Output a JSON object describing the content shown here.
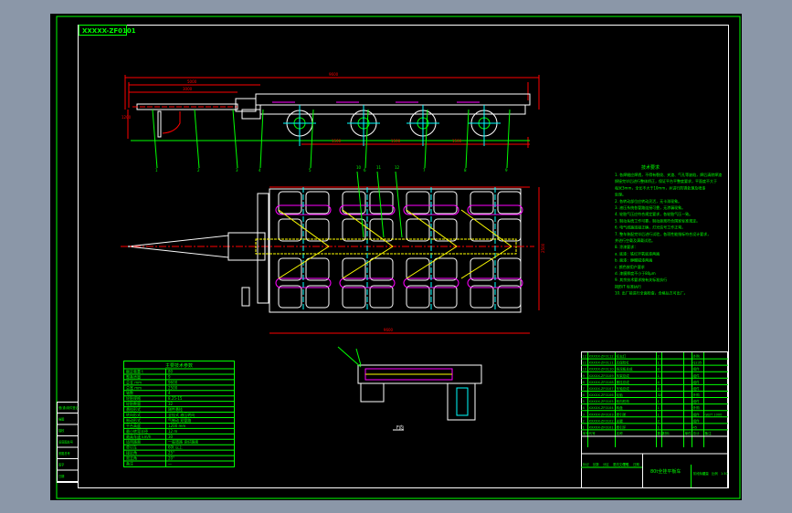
{
  "drawing": {
    "code_label": "XXXXX-ZF0101",
    "colors": {
      "background": "#000000",
      "frame": "#00ff00",
      "border": "#ffffff",
      "dimension": "#ff0000",
      "centerline": "#00ffff",
      "highlight": "#ffff00",
      "accent": "#ff00ff",
      "app_chrome": "#8b97a8"
    },
    "side_view": {
      "dimensions": [
        "9600",
        "5000",
        "3000",
        "1500",
        "1500",
        "1500",
        "1200"
      ],
      "balloons": [
        "1",
        "2",
        "3",
        "4",
        "5",
        "6",
        "7",
        "8",
        "9"
      ]
    },
    "top_view": {
      "dimensions": [
        "9600",
        "2500"
      ],
      "balloons": [
        "10",
        "11",
        "12"
      ]
    },
    "tech_requirements": {
      "title": "技术要求",
      "lines": [
        "1. 各焊缝应焊透，不得有裂纹、夹渣、气孔等缺陷，焊后清除焊渣",
        "   焊接完毕后进行整体矫正，保证平台平整度要求，平面度不大于",
        "   每米3mm，全长不大于10mm，并进行防锈处理及喷漆",
        "   处理。",
        "2. 各转动部位应转动灵活，无卡滞现象。",
        "3. 液压系统各管路连接可靠，无渗漏现象。",
        "4. 轮胎气压应符合规定要求，各轮胎气压一致。",
        "5. 制动系统工作可靠，制动距离符合国家标准规定。",
        "6. 电气线路连接正确，灯光信号工作正常。",
        "7. 整车装配完毕后进行试验，各项性能指标符合设计要求，",
        "   并进行空载及满载试验。",
        "8. 涂漆要求：",
        "  a. 底漆：铁红环氧底漆两遍",
        "  b. 面漆：醇酸磁漆两遍",
        "  c. 颜色按用户要求",
        "  d. 漆膜厚度不小于80μm",
        "9. 其余技术要求按有关标准执行",
        "        按JB/T 标准执行",
        "10. 出厂前进行全面检查，合格后方可出厂。"
      ]
    },
    "parameters": {
      "title": "主要技术参数",
      "rows": [
        [
          "额定载重 t",
          "80"
        ],
        [
          "整备质量",
          "9"
        ],
        [
          "总长 mm",
          "9600"
        ],
        [
          "总宽 mm",
          "2500"
        ],
        [
          "轴数",
          "4"
        ],
        [
          "轮胎规格",
          "8.25-15"
        ],
        [
          "轮胎数量",
          "32"
        ],
        [
          "悬挂形式",
          "刚性悬挂"
        ],
        [
          "转向形式",
          "全挂式 液压转向"
        ],
        [
          "制动形式",
          "气制动 双管路"
        ],
        [
          "平台高度",
          "1200 mm"
        ],
        [
          "最小转弯半径",
          "12 m"
        ],
        [
          "最高车速 km/h",
          "30"
        ],
        [
          "适用路面",
          "一般道路 良好路面"
        ],
        [
          "牵引车",
          "60t 以上"
        ],
        [
          "接近角",
          "25°"
        ],
        [
          "离去角",
          "20°"
        ],
        [
          "备注",
          "—"
        ]
      ]
    },
    "parts_list": {
      "rows": [
        [
          "12",
          "XXXXX-ZF0112",
          "标志灯",
          "2",
          "",
          "",
          "外购",
          ""
        ],
        [
          "11",
          "XXXXX-ZF0111",
          "后保险杠",
          "1",
          "",
          "",
          "Q235",
          ""
        ],
        [
          "10",
          "XXXXX-ZF0110",
          "挡泥板总成",
          "8",
          "",
          "",
          "组件",
          ""
        ],
        [
          "9",
          "XXXXX-ZF0109",
          "车架总成",
          "1",
          "",
          "",
          "组件",
          ""
        ],
        [
          "8",
          "XXXXX-ZF0108",
          "悬挂总成",
          "4",
          "",
          "",
          "组件",
          ""
        ],
        [
          "7",
          "XXXXX-ZF0107",
          "车轴总成",
          "4",
          "",
          "",
          "组件",
          ""
        ],
        [
          "6",
          "XXXXX-ZF0106",
          "轮胎",
          "32",
          "",
          "",
          "外购",
          ""
        ],
        [
          "5",
          "XXXXX-ZF0105",
          "转向机构",
          "1",
          "",
          "",
          "组件",
          ""
        ],
        [
          "4",
          "XXXXX-ZF0104",
          "转盘",
          "1",
          "",
          "",
          "外购",
          ""
        ],
        [
          "3",
          "XXXXX-ZF0103",
          "牵引架",
          "1",
          "",
          "",
          "组件",
          "GB/T 1000"
        ],
        [
          "2",
          "XXXXX-ZF0102",
          "支腿",
          "2",
          "",
          "",
          "组件",
          ""
        ],
        [
          "1",
          "XXXXX-ZF0101",
          "牵引环",
          "1",
          "",
          "",
          "45",
          ""
        ]
      ],
      "header": [
        "序号",
        "代号",
        "名称",
        "数量",
        "材料",
        "单件",
        "总计",
        "备注"
      ]
    },
    "title_block": {
      "drawing_name": "80t全挂平板车",
      "labels": [
        "标记",
        "处数",
        "分区",
        "更改文件号",
        "签名",
        "日期"
      ],
      "right_labels": [
        "阶段标记",
        "重量",
        "比例",
        "1:30"
      ]
    },
    "side_strip": [
      "借(通)用件登记",
      "描图",
      "描校",
      "旧底图总号",
      "底图总号",
      "签字",
      "日期"
    ],
    "detail_label": "F向"
  }
}
